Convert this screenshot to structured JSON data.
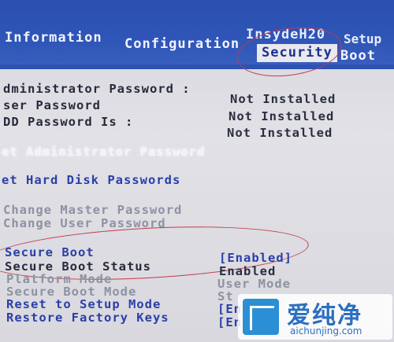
{
  "header": {
    "brand": "InsydeH20",
    "brand_suffix": "Setup",
    "tabs": [
      {
        "label": "Information"
      },
      {
        "label": "Configuration"
      },
      {
        "label": "Security"
      },
      {
        "label": "Boot"
      }
    ]
  },
  "status": [
    {
      "label": "dministrator Password :",
      "value": "Not Installed"
    },
    {
      "label": "ser Password",
      "value": "Not Installed"
    },
    {
      "label": "DD Password Is :",
      "value": "Not Installed"
    }
  ],
  "actions": {
    "set_admin": "et Administrator Password",
    "set_hdd": "et Hard Disk Passwords",
    "change_master": "Change Master Password",
    "change_user": "Change User Password"
  },
  "secure": [
    {
      "label": "Secure Boot",
      "value": "[Enabled]"
    },
    {
      "label": "Secure Boot Status",
      "value": "Enabled"
    },
    {
      "label": "Platform Mode",
      "value": "User Mode"
    },
    {
      "label": "Secure Boot Mode",
      "value": "St"
    },
    {
      "label": "Reset to Setup Mode",
      "value": "[En"
    },
    {
      "label": "Restore Factory Keys",
      "value": "[En"
    }
  ],
  "watermark": {
    "cn": "爱纯净",
    "url": "aichunjing.com"
  },
  "colors": {
    "bar": "#2a4fb0",
    "annotation": "#c23a4a",
    "highlight": "#e9e9ee"
  }
}
